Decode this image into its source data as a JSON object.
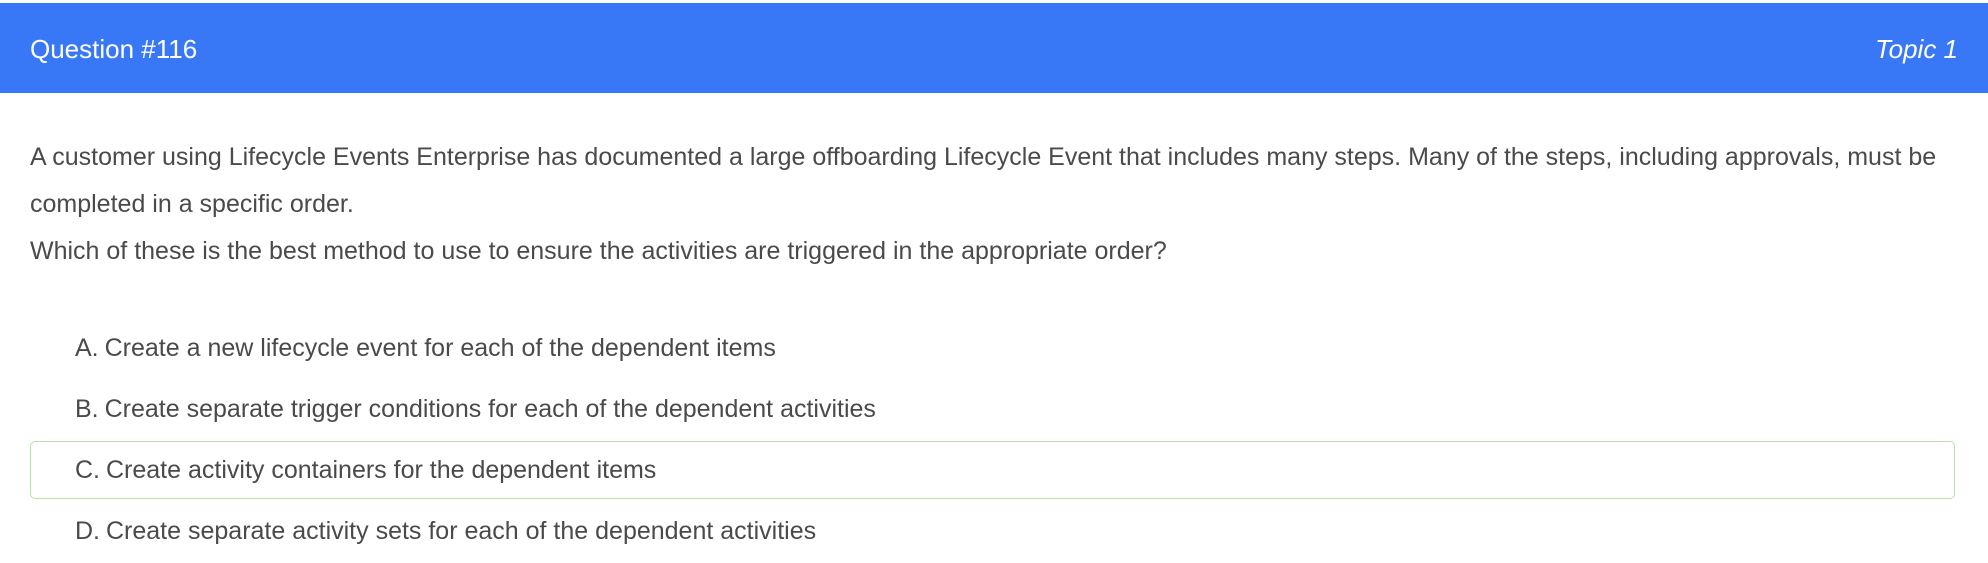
{
  "header": {
    "question_number": "Question #116",
    "topic": "Topic 1"
  },
  "question": {
    "paragraphs": [
      "A customer using Lifecycle Events Enterprise has documented a large offboarding Lifecycle Event that includes many steps. Many of the steps, including approvals, must be completed in a specific order.",
      "Which of these is the best method to use to ensure the activities are triggered in the appropriate order?"
    ]
  },
  "choices": [
    {
      "letter": "A.",
      "text": "Create a new lifecycle event for each of the dependent items"
    },
    {
      "letter": "B.",
      "text": "Create separate trigger conditions for each of the dependent activities"
    },
    {
      "letter": "C.",
      "text": "Create activity containers for the dependent items"
    },
    {
      "letter": "D.",
      "text": "Create separate activity sets for each of the dependent activities"
    }
  ],
  "colors": {
    "header_bg": "#3878f6",
    "highlight_border": "#b3e5a6",
    "text": "#4a4a4a"
  }
}
